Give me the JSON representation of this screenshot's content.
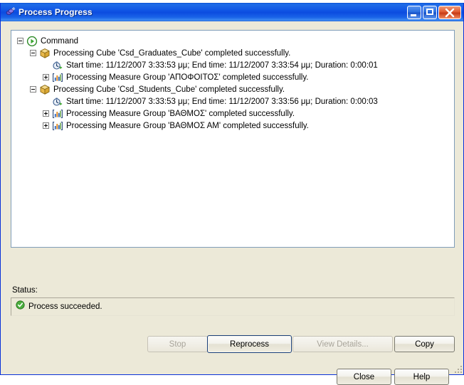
{
  "window": {
    "title": "Process Progress",
    "app_icon": "process-progress-icon",
    "minimize_label": "Minimize",
    "maximize_label": "Maximize",
    "close_label": "Close"
  },
  "tree": {
    "nodes": [
      {
        "label": "Command",
        "icon": "green-play-circle-icon",
        "toggle": "minus",
        "indent": 0
      },
      {
        "label": "Processing Cube 'Csd_Graduates_Cube' completed successfully.",
        "icon": "cube-icon",
        "toggle": "minus",
        "indent": 1
      },
      {
        "label": "Start time: 11/12/2007 3:33:53 μμ; End time: 11/12/2007 3:33:54 μμ; Duration: 0:00:01",
        "icon": "clock-icon",
        "toggle": "none",
        "indent": 2
      },
      {
        "label": "Processing Measure Group 'ΑΠΟΦΟΙΤΟΣ' completed successfully.",
        "icon": "measure-group-icon",
        "toggle": "plus",
        "indent": 2
      },
      {
        "label": "Processing Cube 'Csd_Students_Cube' completed successfully.",
        "icon": "cube-icon",
        "toggle": "minus",
        "indent": 1
      },
      {
        "label": "Start time: 11/12/2007 3:33:53 μμ; End time: 11/12/2007 3:33:56 μμ; Duration: 0:00:03",
        "icon": "clock-icon",
        "toggle": "none",
        "indent": 2
      },
      {
        "label": "Processing Measure Group 'ΒΑΘΜΟΣ' completed successfully.",
        "icon": "measure-group-icon",
        "toggle": "plus",
        "indent": 2
      },
      {
        "label": "Processing Measure Group 'ΒΑΘΜΟΣ ΑΜ' completed successfully.",
        "icon": "measure-group-icon",
        "toggle": "plus",
        "indent": 2
      }
    ]
  },
  "status": {
    "label": "Status:",
    "message": "Process succeeded.",
    "icon": "success-check-icon"
  },
  "buttons": {
    "stop": "Stop",
    "reprocess": "Reprocess",
    "view_details": "View Details...",
    "copy": "Copy",
    "close": "Close",
    "help": "Help"
  },
  "colors": {
    "title_bar_blue": "#0c4ce0",
    "dialog_face": "#ece9d8",
    "success_green": "#2e8b27",
    "cube_orange": "#e8b84b",
    "close_button_red": "#c63a16"
  }
}
